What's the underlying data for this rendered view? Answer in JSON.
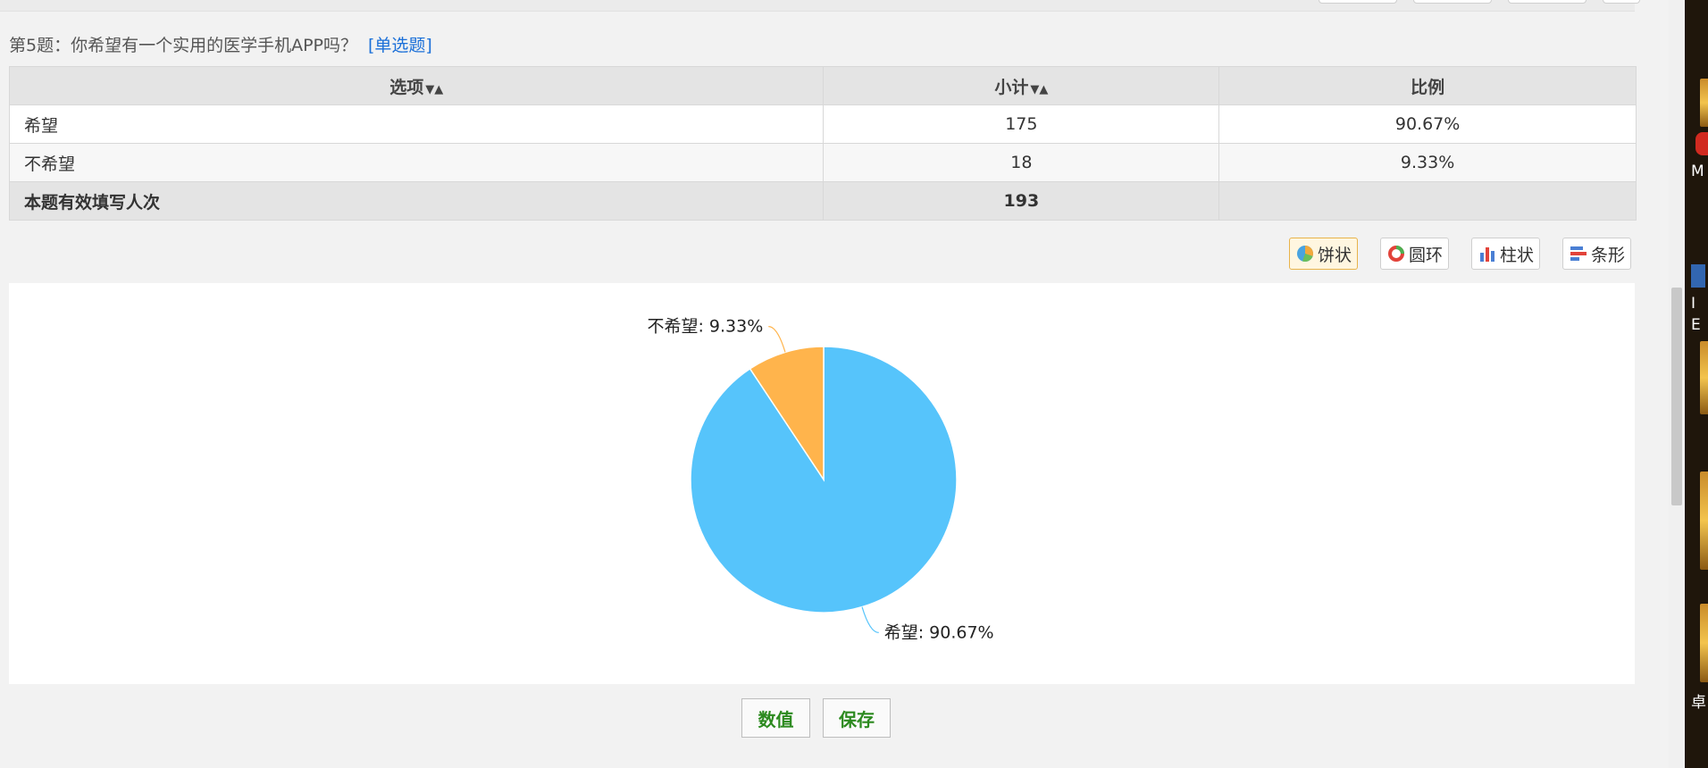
{
  "question": {
    "title": "第5题：你希望有一个实用的医学手机APP吗？",
    "type": "[单选题]"
  },
  "table": {
    "headers": {
      "option": "选项",
      "count": "小计",
      "ratio": "比例"
    },
    "sort_glyph": "▼▲",
    "rows": [
      {
        "option": "希望",
        "count": "175",
        "ratio": "90.67%"
      },
      {
        "option": "不希望",
        "count": "18",
        "ratio": "9.33%"
      }
    ],
    "total": {
      "label": "本题有效填写人次",
      "count": "193"
    }
  },
  "chart_types": [
    {
      "label": "饼状",
      "icon": "pie-icon",
      "active": true
    },
    {
      "label": "圆环",
      "icon": "ring-icon",
      "active": false
    },
    {
      "label": "柱状",
      "icon": "column-icon",
      "active": false
    },
    {
      "label": "条形",
      "icon": "bar-icon",
      "active": false
    }
  ],
  "chart_data": {
    "type": "pie",
    "categories": [
      "希望",
      "不希望"
    ],
    "values": [
      90.67,
      9.33
    ],
    "labels": [
      "希望: 90.67%",
      "不希望: 9.33%"
    ],
    "colors": [
      "#56c4fb",
      "#ffb44c"
    ]
  },
  "actions": {
    "values_label": "数值",
    "save_label": "保存"
  },
  "desktop": {
    "labels": [
      "M",
      "I",
      "E",
      "卓"
    ]
  },
  "colors": {
    "accent_link": "#1a6fd8",
    "action_text": "#2c8a1f",
    "active_border": "#e8b34a"
  }
}
